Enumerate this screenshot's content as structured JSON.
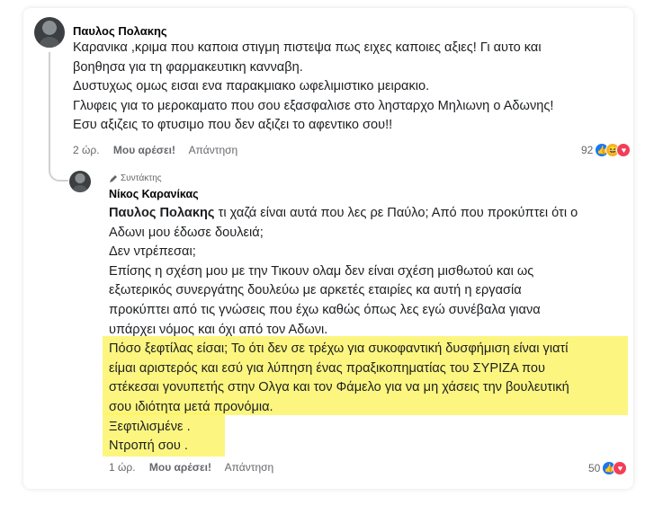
{
  "comment": {
    "author": "Παυλος Πολακης",
    "lines": [
      "Καρανικα ,κριμα που καποια στιγμη πιστεψα πως ειχες καποιες αξιες! Γι αυτο και",
      "βοηθησα για τη φαρμακευτικη κανναβη.",
      "Δυστυχως ομως εισαι ενα παρακμιακο ωφελιμιστικο μειρακιο.",
      "Γλυφεις για το μεροκαματο που σου εξασφαλισε στο λησταρχο Μηλιωνη ο Αδωνης!",
      "Εσυ αξιζεις το φτυσιμο που δεν αξιζει το αφεντικο σου!!"
    ],
    "time": "2 ώρ.",
    "like_label": "Μου αρέσει!",
    "reply_label": "Απάντηση",
    "reaction_count": "92"
  },
  "reply": {
    "badge": "Συντάκτης",
    "author": "Νίκος Καρανίκας",
    "mention": "Παυλος Πολακης",
    "lines": [
      " τι χαζά είναι αυτά που λες ρε Παύλο; Από που προκύπτει ότι ο",
      "Αδωνι μου έδωσε δουλειά;",
      "Δεν ντρέπεσαι;",
      "Επίσης η σχέση μου με την Τικουν ολαμ δεν είναι σχέση μισθωτού και ως",
      "εξωτερικός συνεργάτης δουλεύω με αρκετές εταιρίες κα αυτή η εργασία",
      "προκύπτει από τις γνώσεις που έχω καθώς όπως λες εγώ συνέβαλα γιανα",
      "υπάρχει νόμος και όχι από τον Αδωνι.",
      "Πόσο ξεφτίλας είσαι; Το ότι δεν σε τρέχω για συκοφαντική δυσφήμιση είναι γιατί",
      "είμαι αριστερός και εσύ για λύπηση ένας πραξικοπηματίας του ΣΥΡΙΖΑ που",
      "στέκεσαι γονυπετής στην Ολγα και τον Φάμελο για να μη χάσεις την βουλευτική",
      "σου ιδιότητα μετά προνόμια.",
      "Ξεφτιλισμένε .",
      "Ντροπή σου ."
    ],
    "time": "1 ώρ.",
    "like_label": "Μου αρέσει!",
    "reply_label": "Απάντηση",
    "reaction_count": "50"
  },
  "colors": {
    "highlight": "#fbf46a",
    "like_blue": "#1877f2",
    "haha_yellow": "#f7b125",
    "love_red": "#f33e58"
  }
}
